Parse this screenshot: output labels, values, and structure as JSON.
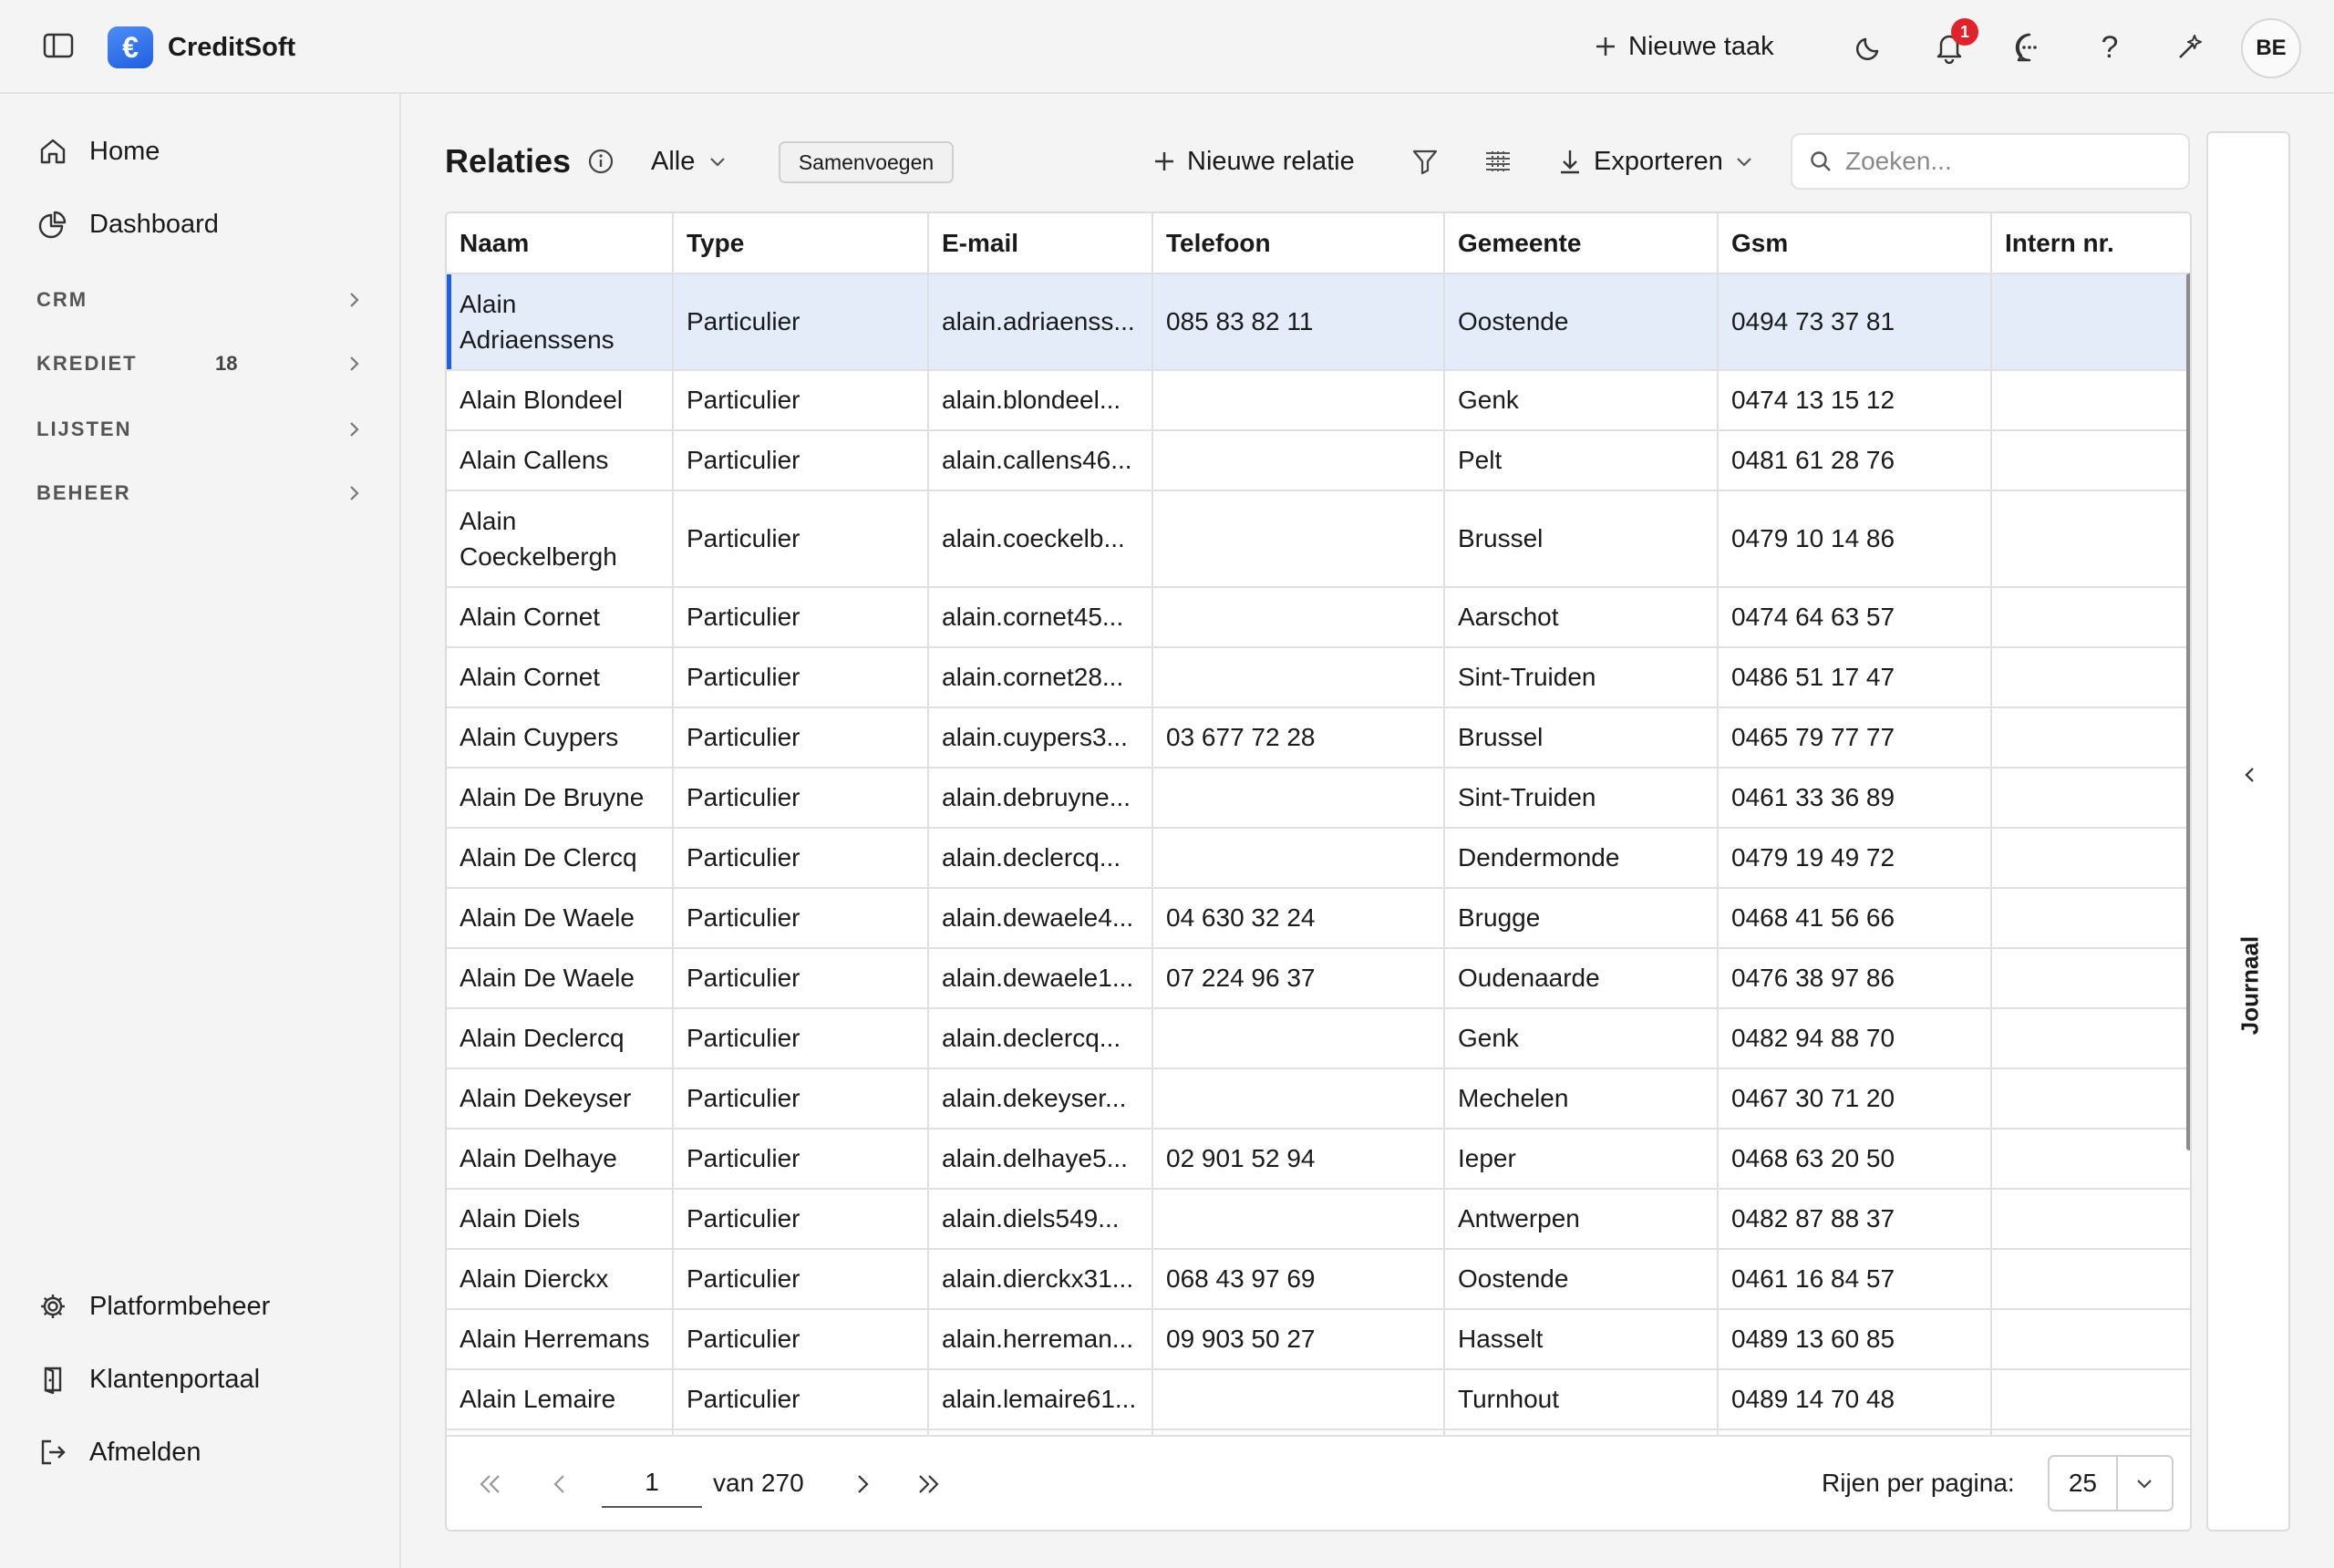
{
  "app": {
    "name": "CreditSoft",
    "logo_glyph": "€",
    "accent": "#1f5fe0"
  },
  "topbar": {
    "new_task_label": "Nieuwe taak",
    "notification_count": "1",
    "avatar_initials": "BE"
  },
  "sidebar": {
    "top_items": [
      {
        "label": "Home",
        "icon": "home-icon"
      },
      {
        "label": "Dashboard",
        "icon": "pie-chart-icon"
      }
    ],
    "sections": [
      {
        "label": "CRM",
        "count": ""
      },
      {
        "label": "KREDIET",
        "count": "18"
      },
      {
        "label": "LIJSTEN",
        "count": ""
      },
      {
        "label": "BEHEER",
        "count": ""
      }
    ],
    "bottom_items": [
      {
        "label": "Platformbeheer",
        "icon": "gear-icon"
      },
      {
        "label": "Klantenportaal",
        "icon": "door-icon"
      },
      {
        "label": "Afmelden",
        "icon": "logout-icon"
      }
    ]
  },
  "main": {
    "title": "Relaties",
    "filter_value": "Alle",
    "merge_label": "Samenvoegen",
    "new_relation_label": "Nieuwe relatie",
    "export_label": "Exporteren",
    "search_placeholder": "Zoeken..."
  },
  "table": {
    "columns": [
      "Naam",
      "Type",
      "E-mail",
      "Telefoon",
      "Gemeente",
      "Gsm",
      "Intern nr."
    ],
    "rows": [
      [
        "Alain Adriaenssens",
        "Particulier",
        "alain.adriaenss...",
        "085 83 82 11",
        "Oostende",
        "0494 73 37 81",
        ""
      ],
      [
        "Alain Blondeel",
        "Particulier",
        "alain.blondeel...",
        "",
        "Genk",
        "0474 13 15 12",
        ""
      ],
      [
        "Alain Callens",
        "Particulier",
        "alain.callens46...",
        "",
        "Pelt",
        "0481 61 28 76",
        ""
      ],
      [
        "Alain Coeckelbergh",
        "Particulier",
        "alain.coeckelb...",
        "",
        "Brussel",
        "0479 10 14 86",
        ""
      ],
      [
        "Alain Cornet",
        "Particulier",
        "alain.cornet45...",
        "",
        "Aarschot",
        "0474 64 63 57",
        ""
      ],
      [
        "Alain Cornet",
        "Particulier",
        "alain.cornet28...",
        "",
        "Sint-Truiden",
        "0486 51 17 47",
        ""
      ],
      [
        "Alain Cuypers",
        "Particulier",
        "alain.cuypers3...",
        "03 677 72 28",
        "Brussel",
        "0465 79 77 77",
        ""
      ],
      [
        "Alain De Bruyne",
        "Particulier",
        "alain.debruyne...",
        "",
        "Sint-Truiden",
        "0461 33 36 89",
        ""
      ],
      [
        "Alain De Clercq",
        "Particulier",
        "alain.declercq...",
        "",
        "Dendermonde",
        "0479 19 49 72",
        ""
      ],
      [
        "Alain De Waele",
        "Particulier",
        "alain.dewaele4...",
        "04 630 32 24",
        "Brugge",
        "0468 41 56 66",
        ""
      ],
      [
        "Alain De Waele",
        "Particulier",
        "alain.dewaele1...",
        "07 224 96 37",
        "Oudenaarde",
        "0476 38 97 86",
        ""
      ],
      [
        "Alain Declercq",
        "Particulier",
        "alain.declercq...",
        "",
        "Genk",
        "0482 94 88 70",
        ""
      ],
      [
        "Alain Dekeyser",
        "Particulier",
        "alain.dekeyser...",
        "",
        "Mechelen",
        "0467 30 71 20",
        ""
      ],
      [
        "Alain Delhaye",
        "Particulier",
        "alain.delhaye5...",
        "02 901 52 94",
        "Ieper",
        "0468 63 20 50",
        ""
      ],
      [
        "Alain Diels",
        "Particulier",
        "alain.diels549...",
        "",
        "Antwerpen",
        "0482 87 88 37",
        ""
      ],
      [
        "Alain Dierckx",
        "Particulier",
        "alain.dierckx31...",
        "068 43 97 69",
        "Oostende",
        "0461 16 84 57",
        ""
      ],
      [
        "Alain Herremans",
        "Particulier",
        "alain.herreman...",
        "09 903 50 27",
        "Hasselt",
        "0489 13 60 85",
        ""
      ],
      [
        "Alain Lemaire",
        "Particulier",
        "alain.lemaire61...",
        "",
        "Turnhout",
        "0489 14 70 48",
        ""
      ]
    ]
  },
  "pagination": {
    "current_page": "1",
    "of_label": "van 270",
    "rows_label": "Rijen per pagina:",
    "rows_value": "25"
  },
  "journal": {
    "label": "Journaal"
  }
}
